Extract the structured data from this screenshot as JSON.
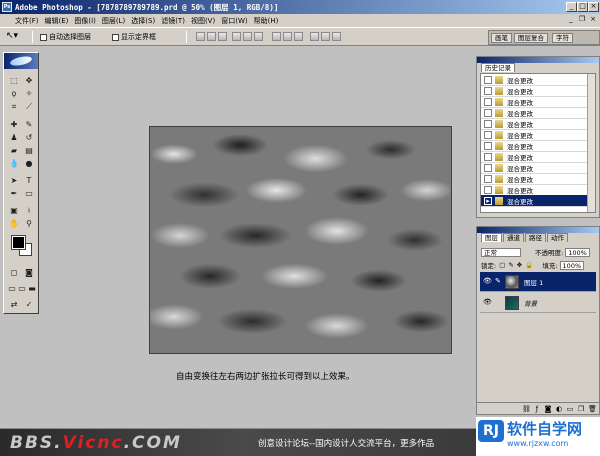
{
  "window": {
    "title": "Adobe Photoshop - [7878789789789.prd @ 50% (图层 1, RGB/8)]",
    "controls": {
      "minimize": "_",
      "maximize": "□",
      "close": "×"
    }
  },
  "menu": [
    "文件(F)",
    "编辑(E)",
    "图像(I)",
    "图层(L)",
    "选择(S)",
    "滤镜(T)",
    "视图(V)",
    "窗口(W)",
    "帮助(H)"
  ],
  "options": {
    "auto_select_layer": "自动选择图层",
    "show_bounding_box": "显示定界框"
  },
  "palette_well": [
    "画笔",
    "图层复合",
    "字符"
  ],
  "history": {
    "tab": "历史记录",
    "items": [
      "混合更改",
      "混合更改",
      "混合更改",
      "混合更改",
      "混合更改",
      "混合更改",
      "混合更改",
      "混合更改",
      "混合更改",
      "混合更改",
      "混合更改",
      "混合更改"
    ],
    "selected_index": 11
  },
  "layers": {
    "tabs": [
      "图层",
      "通道",
      "路径",
      "动作"
    ],
    "blend_mode": "正常",
    "opacity_label": "不透明度:",
    "opacity": "100%",
    "lock_label": "锁定:",
    "fill_label": "填充:",
    "fill": "100%",
    "items": [
      {
        "name": "图层 1",
        "selected": true
      },
      {
        "name": "背景",
        "selected": false
      }
    ]
  },
  "caption": "自由变换往左右两边扩张拉长可得到以上效果。",
  "footer": {
    "site_a": "BBS.",
    "site_b": "Vicnc",
    "site_c": ".COM",
    "slogan": "创意设计论坛--国内设计人交流平台，更多作品",
    "logo_cn": "软件自学网",
    "logo_url": "www.rjzxw.com",
    "logo_mark": "RJ"
  },
  "colors": {
    "titlebar": "#0a246a",
    "selection": "#0a246a",
    "ui_gray": "#d4d0c8",
    "workspace": "#c0c0c0",
    "logo_blue": "#1e6fd0"
  }
}
